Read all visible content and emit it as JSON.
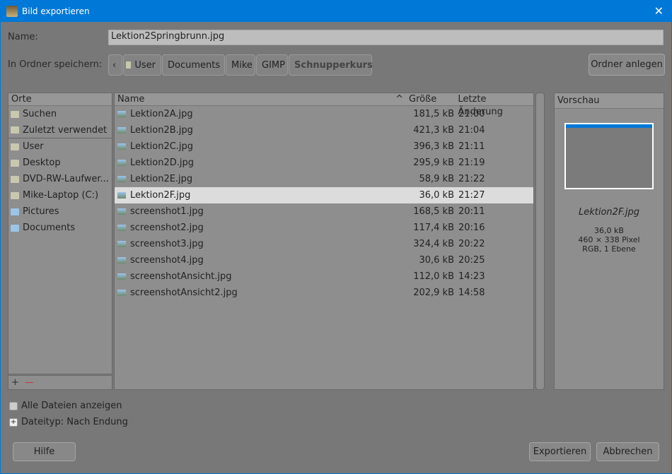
{
  "window": {
    "title": "Bild exportieren"
  },
  "name_label": "Name:",
  "name_value": "Lektion2Springbrunn.jpg",
  "folder_label": "In Ordner speichern:",
  "breadcrumbs": [
    "User",
    "Documents",
    "Mike",
    "GIMP",
    "Schnupperkurs"
  ],
  "create_folder": "Ordner anlegen",
  "places": {
    "header": "Orte",
    "items": [
      "Suchen",
      "Zuletzt verwendet",
      "User",
      "Desktop",
      "DVD-RW-Laufwer...",
      "Mike-Laptop (C:)",
      "Pictures",
      "Documents"
    ]
  },
  "files": {
    "columns": [
      "Name",
      "Größe",
      "Letzte Änderung"
    ],
    "rows": [
      {
        "name": "Lektion2A.jpg",
        "size": "181,5 kB",
        "time": "21:00"
      },
      {
        "name": "Lektion2B.jpg",
        "size": "421,3 kB",
        "time": "21:04"
      },
      {
        "name": "Lektion2C.jpg",
        "size": "396,3 kB",
        "time": "21:11"
      },
      {
        "name": "Lektion2D.jpg",
        "size": "295,9 kB",
        "time": "21:19"
      },
      {
        "name": "Lektion2E.jpg",
        "size": "58,9 kB",
        "time": "21:22"
      },
      {
        "name": "Lektion2F.jpg",
        "size": "36,0 kB",
        "time": "21:27"
      },
      {
        "name": "screenshot1.jpg",
        "size": "168,5 kB",
        "time": "20:11"
      },
      {
        "name": "screenshot2.jpg",
        "size": "117,4 kB",
        "time": "20:16"
      },
      {
        "name": "screenshot3.jpg",
        "size": "324,4 kB",
        "time": "20:22"
      },
      {
        "name": "screenshot4.jpg",
        "size": "30,6 kB",
        "time": "20:25"
      },
      {
        "name": "screenshotAnsicht.jpg",
        "size": "112,0 kB",
        "time": "14:23"
      },
      {
        "name": "screenshotAnsicht2.jpg",
        "size": "202,9 kB",
        "time": "14:58"
      }
    ]
  },
  "preview": {
    "header": "Vorschau",
    "filename": "Lektion2F.jpg",
    "size": "36,0 kB",
    "dims": "460 × 338 Pixel",
    "mode": "RGB, 1 Ebene"
  },
  "show_all": "Alle Dateien anzeigen",
  "filetype": "Dateityp: Nach Endung",
  "buttons": {
    "help": "Hilfe",
    "export": "Exportieren",
    "cancel": "Abbrechen"
  }
}
